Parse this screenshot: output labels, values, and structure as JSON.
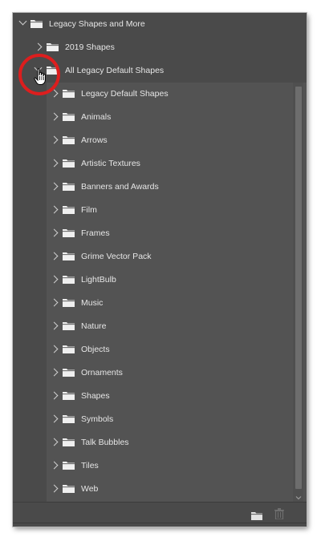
{
  "tree": {
    "root": {
      "label": "Legacy Shapes and More",
      "expanded": true
    },
    "children": [
      {
        "label": "2019 Shapes",
        "expanded": false
      },
      {
        "label": "All Legacy Default Shapes",
        "expanded": true
      }
    ],
    "legacy_items": [
      "Legacy Default Shapes",
      "Animals",
      "Arrows",
      "Artistic Textures",
      "Banners and Awards",
      "Film",
      "Frames",
      "Grime Vector Pack",
      "LightBulb",
      "Music",
      "Nature",
      "Objects",
      "Ornaments",
      "Shapes",
      "Symbols",
      "Talk Bubbles",
      "Tiles",
      "Web"
    ]
  },
  "footer": {
    "new_group_icon": "folder-icon",
    "delete_icon": "trash-icon"
  },
  "colors": {
    "panel_bg": "#535353",
    "row_bg_dark": "#4a4a4a",
    "text": "#e6e6e6",
    "highlight": "#dd1e1e"
  }
}
